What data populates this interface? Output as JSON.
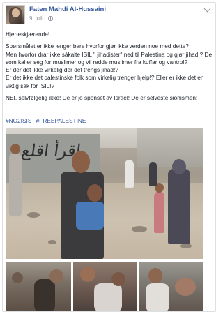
{
  "post": {
    "author": "Faten Mahdi Al-Hussaini",
    "date": "9. juli",
    "privacy_icon": "globe-icon",
    "menu_icon": "chevron-down-icon",
    "paragraphs": [
      "Hjerteskjærende!",
      "Spørsmålet er ikke lenger bare hvorfor gjør ikke verden noe med dette?",
      "Men hvorfor drar ikke såkalte ISIL \" jihadister\" ned til Palestina og gjør jihad!? De som kaller seg for muslimer og vil redde muslimer fra kuffar og vantro!?",
      "Er der det ikke virkelig der det trengs jihad!?",
      "Er det ikke det palestinske folk som virkelig trenger hjelp!? Eller er ikke det en viktig sak for ISIL!?",
      "NEI, selvfølgelig ikke! De er jo sponset av Israel! De er selveste sionismen!"
    ],
    "hashtags": [
      "#NO2ISIS",
      "#FREEPALESTINE"
    ],
    "photo_graffiti": "إقرأ اقلع"
  }
}
